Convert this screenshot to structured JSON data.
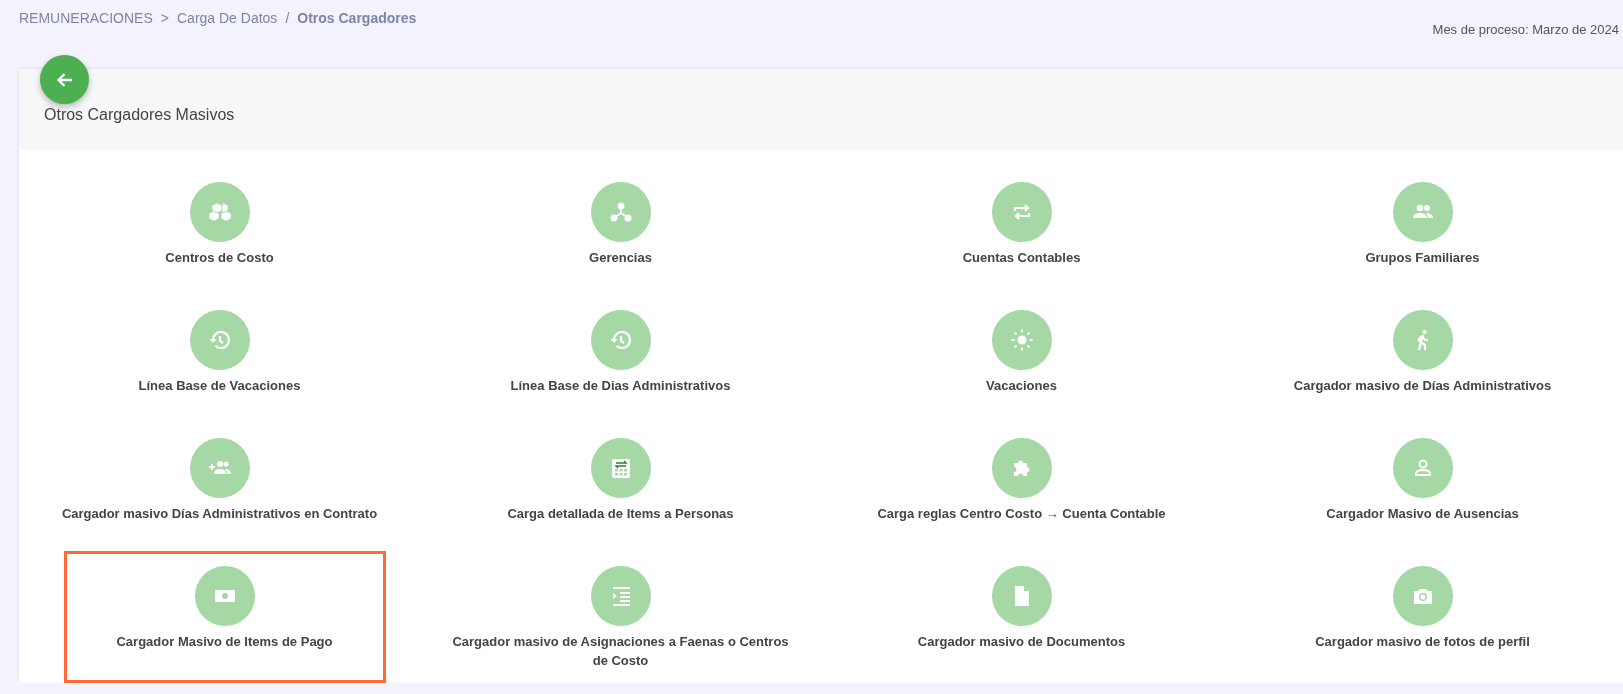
{
  "breadcrumb": [
    {
      "label": "REMUNERACIONES",
      "current": false
    },
    {
      "label": "Carga De Datos",
      "current": false
    },
    {
      "label": "Otros Cargadores",
      "current": true
    }
  ],
  "breadcrumb_separators": [
    ">",
    "/"
  ],
  "process_month": "Mes de proceso: Marzo de 2024",
  "card": {
    "title": "Otros Cargadores Masivos",
    "items": [
      {
        "label": "Centros de Costo",
        "highlighted": false
      },
      {
        "label": "Gerencias",
        "highlighted": false
      },
      {
        "label": "Cuentas Contables",
        "highlighted": false
      },
      {
        "label": "Grupos Familiares",
        "highlighted": false
      },
      {
        "label": "Línea Base de Vacaciones",
        "highlighted": false
      },
      {
        "label": "Línea Base de Dias Administrativos",
        "highlighted": false
      },
      {
        "label": "Vacaciones",
        "highlighted": false
      },
      {
        "label": "Cargador masivo de Días Administrativos",
        "highlighted": false
      },
      {
        "label": "Cargador masivo Días Administrativos en Contrato",
        "highlighted": false
      },
      {
        "label": "Carga detallada de Items a Personas",
        "highlighted": false
      },
      {
        "label": "Carga reglas Centro Costo → Cuenta Contable",
        "highlighted": false
      },
      {
        "label": "Cargador Masivo de Ausencias",
        "highlighted": false
      },
      {
        "label": "Cargador Masivo de Items de Pago",
        "highlighted": true
      },
      {
        "label": "Cargador masivo de Asignaciones a Faenas o Centros de Costo",
        "highlighted": false
      },
      {
        "label": "Cargador masivo de Documentos",
        "highlighted": false
      },
      {
        "label": "Cargador masivo de fotos de perfil",
        "highlighted": false
      }
    ]
  }
}
